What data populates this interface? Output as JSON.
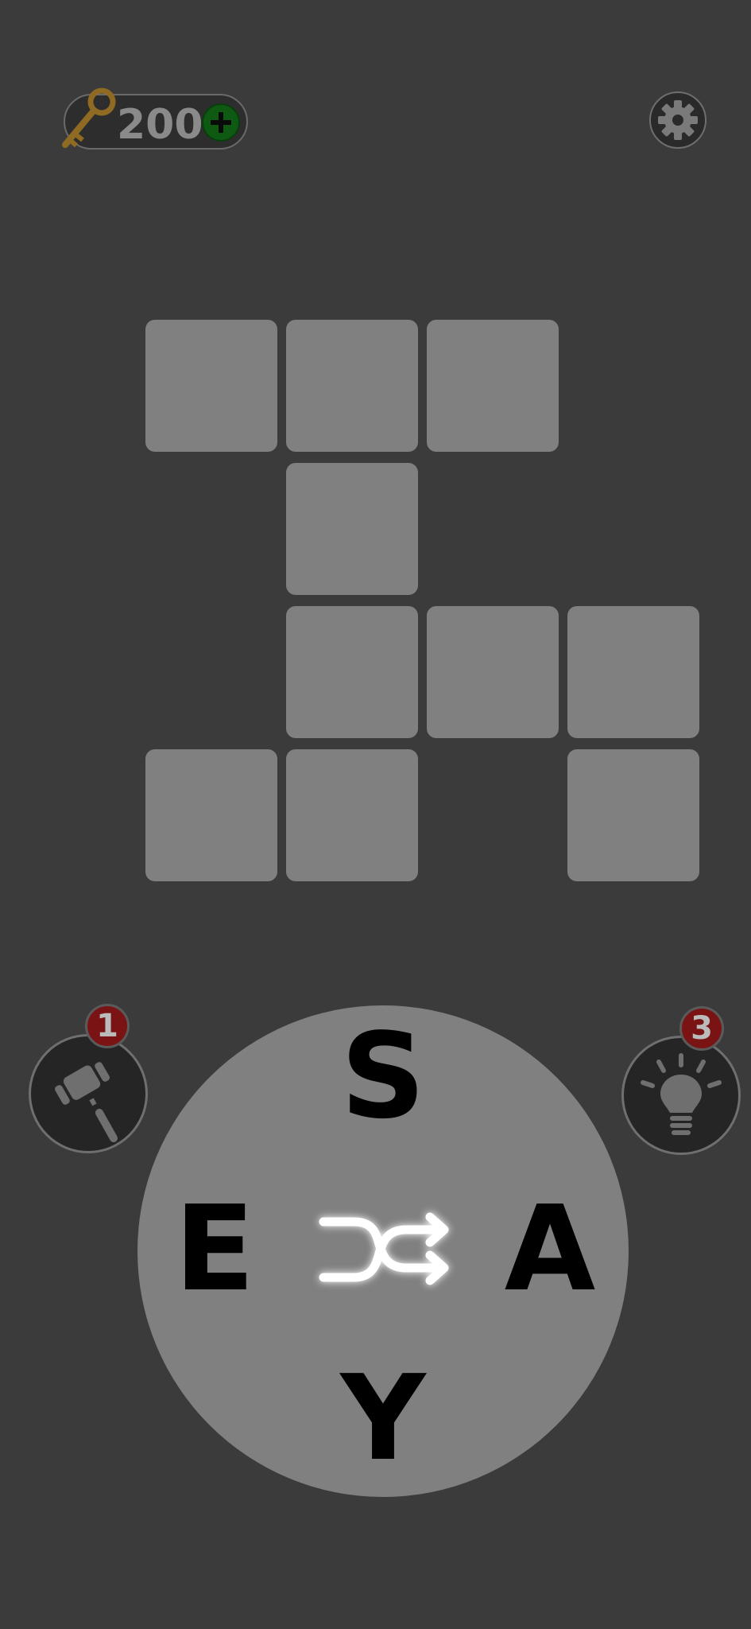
{
  "header": {
    "keys_count": "200",
    "icons": {
      "key": "key-icon",
      "add": "plus-icon",
      "settings": "gear-icon"
    }
  },
  "grid": {
    "tiles": [
      {
        "row": 0,
        "col": 0,
        "letter": ""
      },
      {
        "row": 0,
        "col": 1,
        "letter": ""
      },
      {
        "row": 0,
        "col": 2,
        "letter": ""
      },
      {
        "row": 1,
        "col": 1,
        "letter": ""
      },
      {
        "row": 2,
        "col": 1,
        "letter": ""
      },
      {
        "row": 2,
        "col": 2,
        "letter": ""
      },
      {
        "row": 2,
        "col": 3,
        "letter": ""
      },
      {
        "row": 3,
        "col": 0,
        "letter": ""
      },
      {
        "row": 3,
        "col": 1,
        "letter": ""
      },
      {
        "row": 3,
        "col": 3,
        "letter": ""
      }
    ]
  },
  "tools": {
    "hammer": {
      "count": "1",
      "icon": "hammer-icon"
    },
    "hint": {
      "count": "3",
      "icon": "lightbulb-icon"
    }
  },
  "wheel": {
    "letters": {
      "top": "S",
      "left": "E",
      "right": "A",
      "bottom": "Y"
    },
    "center_icon": "shuffle-icon"
  },
  "colors": {
    "background": "#3b3b3b",
    "tile": "#808080",
    "plus_button": "#0f5a12",
    "badge": "#7a1414"
  }
}
